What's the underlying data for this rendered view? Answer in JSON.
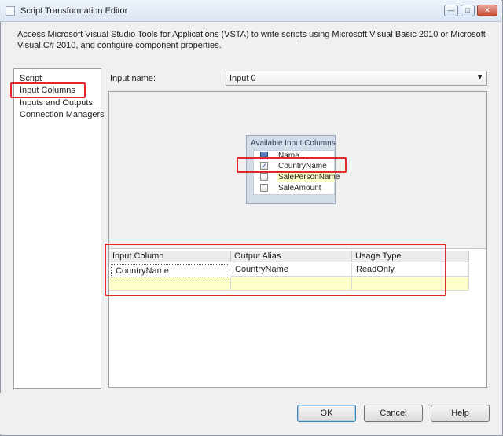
{
  "window": {
    "title": "Script Transformation Editor"
  },
  "description": "Access Microsoft Visual Studio Tools for Applications (VSTA) to write scripts using Microsoft Visual Basic 2010 or Microsoft Visual C# 2010, and configure component properties.",
  "nav": {
    "items": [
      {
        "label": "Script",
        "selected": false
      },
      {
        "label": "Input Columns",
        "selected": true
      },
      {
        "label": "Inputs and Outputs",
        "selected": false
      },
      {
        "label": "Connection Managers",
        "selected": false
      }
    ]
  },
  "input": {
    "label": "Input name:",
    "value": "Input 0"
  },
  "available_columns": {
    "title": "Available Input Columns",
    "header": "Name",
    "rows": [
      {
        "name": "CountryName",
        "checked": true
      },
      {
        "name": "SalePersonName",
        "checked": false
      },
      {
        "name": "SaleAmount",
        "checked": false
      }
    ]
  },
  "grid": {
    "headers": [
      "Input Column",
      "Output Alias",
      "Usage Type"
    ],
    "rows": [
      [
        "CountryName",
        "CountryName",
        "ReadOnly"
      ]
    ]
  },
  "buttons": {
    "ok": "OK",
    "cancel": "Cancel",
    "help": "Help"
  },
  "colors": {
    "highlight_outline": "#e02a2a",
    "new_row": "#ffffcc",
    "panel": "#f0f0f0"
  }
}
